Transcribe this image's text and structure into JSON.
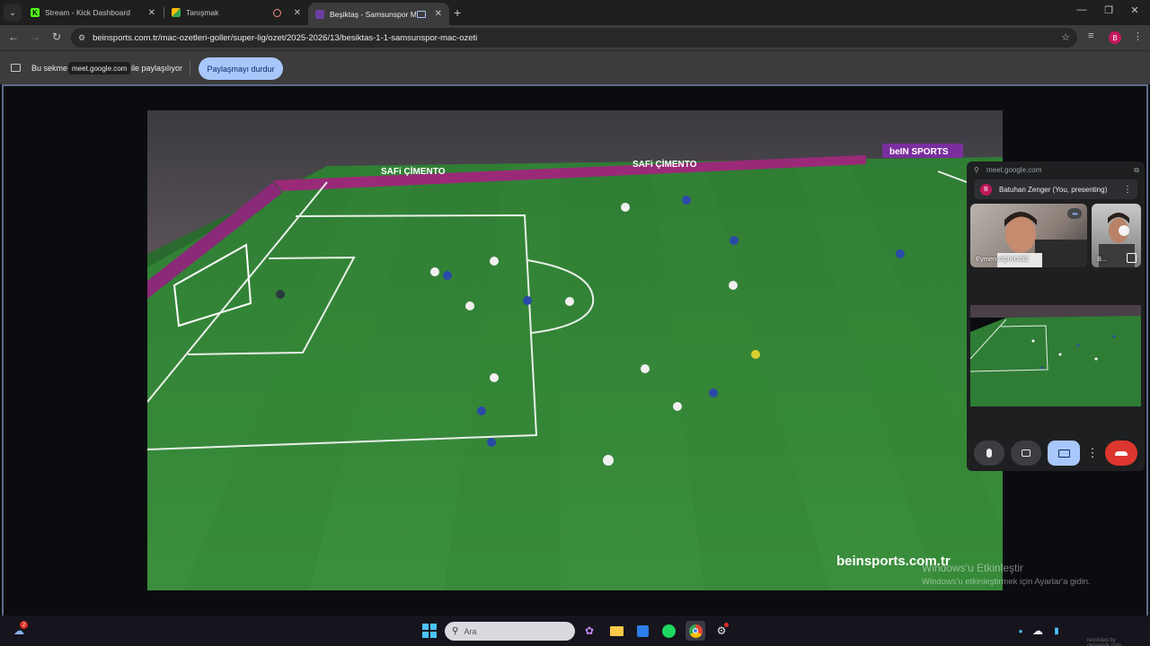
{
  "tabs": [
    {
      "title": "Stream - Kick Dashboard",
      "favicon": "K",
      "active": false
    },
    {
      "title": "Tanışmak",
      "favicon": "",
      "active": false
    },
    {
      "title": "",
      "favicon": "",
      "active": false
    },
    {
      "title": "Beşiktaş - Samsunspor Ma",
      "favicon": "",
      "active": true
    }
  ],
  "address_bar": {
    "url": "beinsports.com.tr/mac-ozetleri-goller/super-lig/ozet/2025-2026/13/besiktas-1-1-samsunspor-mac-ozeti"
  },
  "profile_initial": "B",
  "sharing_bar": {
    "text_before": "Bu sekme",
    "site": "meet.google.com",
    "text_after": "ile paylaşılıyor",
    "stop_button": "Paylaşmayı durdur"
  },
  "video": {
    "watermark": "beinsports.com.tr",
    "scorebug": "beIN SPORTS",
    "ad_text": "SAFi ÇİMENTO"
  },
  "windows_activation": {
    "line1": "Windows'u Etkinleştir",
    "line2": "Windows'u etkinleştirmek için Ayarlar'a gidin."
  },
  "meet_pip": {
    "origin": "meet.google.com",
    "presenter_initial": "B",
    "presenter": "Batuhan Zenger (You, presenting)",
    "participants": [
      {
        "name": "Eymen AÇIKGÖZ"
      },
      {
        "name": "B..."
      }
    ]
  },
  "taskbar": {
    "search_placeholder": "Ara",
    "notification_count": "2"
  },
  "recorder_mark": "recorded by movavi/ik.com",
  "colors": {
    "accent_blue": "#a8c7fa",
    "hangup_red": "#dc362e",
    "pitch_green": "#3a8a3a"
  }
}
